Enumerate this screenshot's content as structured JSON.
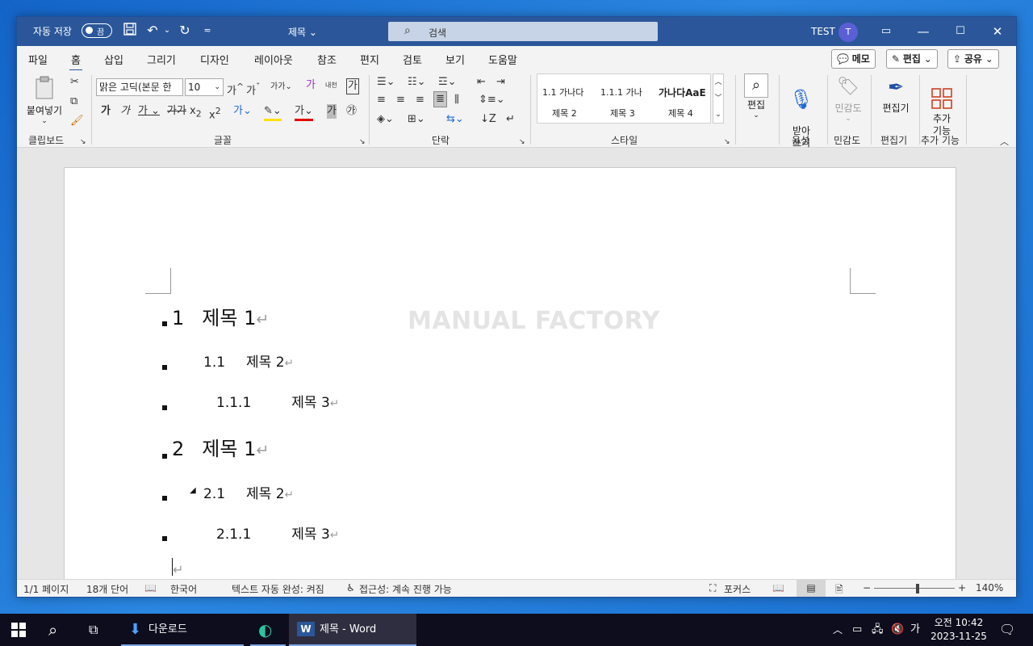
{
  "titlebar": {
    "autosave_label": "자동 저장",
    "autosave_state": "끔",
    "document_title": "제목",
    "search_placeholder": "검색",
    "user_name": "TEST",
    "user_initial": "T"
  },
  "ribbon_tabs": [
    "파일",
    "홈",
    "삽입",
    "그리기",
    "디자인",
    "레이아웃",
    "참조",
    "편지",
    "검토",
    "보기",
    "도움말"
  ],
  "active_tab": "홈",
  "ribbon_actions": {
    "memo": "메모",
    "edit": "편집",
    "share": "공유"
  },
  "ribbon": {
    "clipboard": {
      "paste_label": "붙여넣기",
      "group_label": "클립보드"
    },
    "font": {
      "font_name": "맑은 고딕(본문 한",
      "font_size": "10",
      "group_label": "글꼴"
    },
    "paragraph": {
      "group_label": "단락"
    },
    "styles": {
      "items": [
        {
          "preview": "1.1  가나다",
          "name": "제목 2"
        },
        {
          "preview": "1.1.1  가나",
          "name": "제목 3"
        },
        {
          "preview": "가나다AaE",
          "name": "제목 4"
        }
      ],
      "group_label": "스타일"
    },
    "editing": {
      "label": "편집",
      "group_label": ""
    },
    "voice": {
      "label": "받아\n쓰기",
      "group_label": "음성"
    },
    "sensitivity": {
      "label": "민감도",
      "group_label": "민감도"
    },
    "editor": {
      "label": "편집기",
      "group_label": "편집기"
    },
    "addins": {
      "label": "추가\n기능",
      "group_label": "추가 기능"
    }
  },
  "document": {
    "watermark": "MANUAL FACTORY",
    "lines": [
      {
        "number": "1",
        "text": "제목  1"
      },
      {
        "number": "1.1",
        "text": "제목  2"
      },
      {
        "number": "1.1.1",
        "text": "제목  3"
      },
      {
        "number": "2",
        "text": "제목  1"
      },
      {
        "number": "2.1",
        "text": "제목  2"
      },
      {
        "number": "2.1.1",
        "text": "제목  3"
      }
    ],
    "paragraph_mark": "↵"
  },
  "statusbar": {
    "page": "1/1 페이지",
    "words": "18개 단어",
    "language": "한국어",
    "autocomplete": "텍스트 자동 완성: 켜짐",
    "accessibility": "접근성: 계속 진행 가능",
    "focus": "포커스",
    "zoom": "140%"
  },
  "taskbar": {
    "downloads_label": "다운로드",
    "word_label": "제목 - Word",
    "ime": "가",
    "time": "오전 10:42",
    "date": "2023-11-25"
  },
  "colors": {
    "word_blue": "#2b579a",
    "taskbar": "#0d0d1d",
    "desktop": "#1a6fd0"
  }
}
